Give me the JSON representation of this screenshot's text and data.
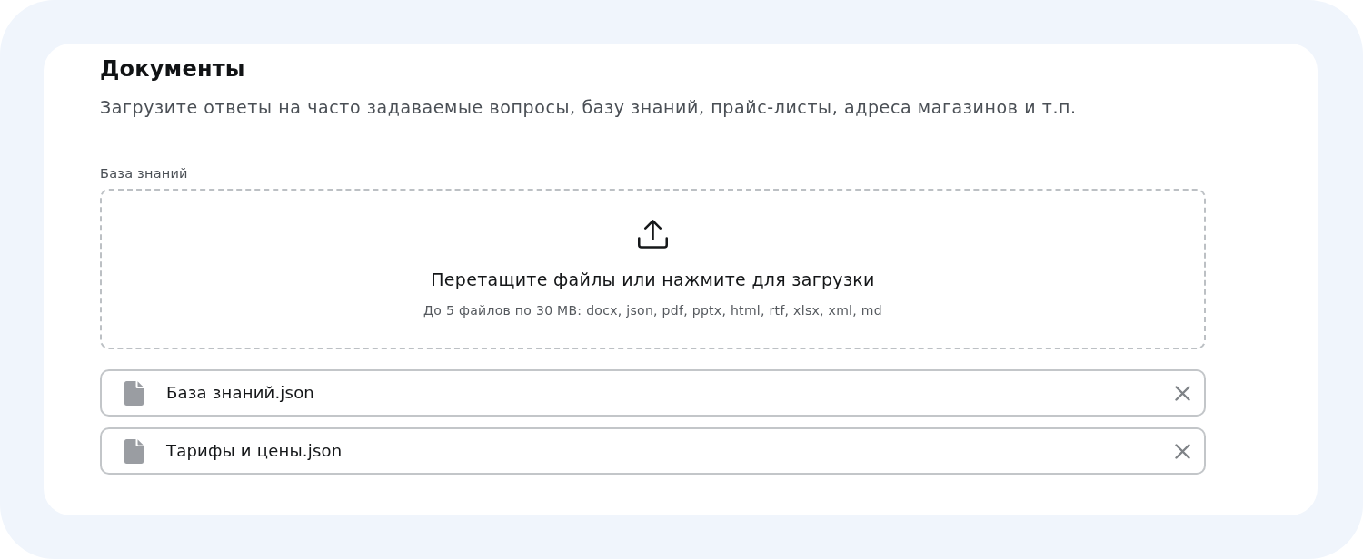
{
  "section": {
    "title": "Документы",
    "description": "Загрузите ответы на часто задаваемые вопросы, базу знаний, прайс-листы, адреса магазинов и т.п."
  },
  "upload": {
    "label": "База знаний",
    "prompt": "Перетащите файлы или нажмите для загрузки",
    "hint": "До 5 файлов по 30 MB: docx, json, pdf, pptx, html, rtf, xlsx, xml, md"
  },
  "files": [
    {
      "name": "База знаний.json"
    },
    {
      "name": "Тарифы и цены.json"
    }
  ]
}
